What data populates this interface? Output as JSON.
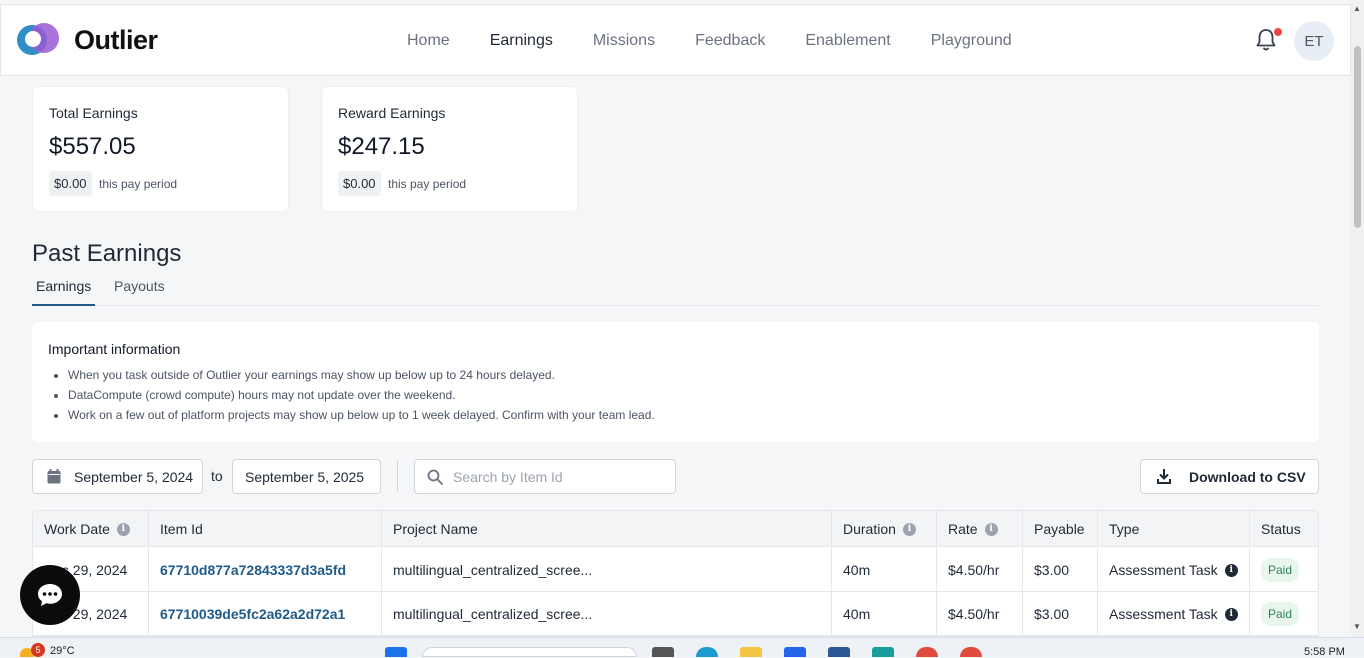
{
  "app": {
    "name": "Outlier",
    "nav": [
      "Home",
      "Earnings",
      "Missions",
      "Feedback",
      "Enablement",
      "Playground"
    ],
    "active_nav": "Earnings",
    "avatar_initials": "ET"
  },
  "cards": [
    {
      "title": "Total Earnings",
      "amount": "$557.05",
      "period_amount": "$0.00",
      "period_label": "this pay period"
    },
    {
      "title": "Reward Earnings",
      "amount": "$247.15",
      "period_amount": "$0.00",
      "period_label": "this pay period"
    }
  ],
  "past_earnings": {
    "title": "Past Earnings",
    "tabs": [
      "Earnings",
      "Payouts"
    ],
    "active_tab": "Earnings"
  },
  "info": {
    "title": "Important information",
    "items": [
      "When you task outside of Outlier your earnings may show up below up to 24 hours delayed.",
      "DataCompute (crowd compute) hours may not update over the weekend.",
      "Work on a few out of platform projects may show up below up to 1 week delayed. Confirm with your team lead."
    ]
  },
  "filters": {
    "start_date": "September 5, 2024",
    "to_label": "to",
    "end_date": "September 5, 2025",
    "search_placeholder": "Search by Item Id",
    "download_label": "Download to CSV"
  },
  "table": {
    "columns": [
      "Work Date",
      "Item Id",
      "Project Name",
      "Duration",
      "Rate",
      "Payable",
      "Type",
      "Status"
    ],
    "rows": [
      {
        "work_date": "Dec 29, 2024",
        "item_id": "67710d877a72843337d3a5fd",
        "project": "multilingual_centralized_scree...",
        "duration": "40m",
        "rate": "$4.50/hr",
        "payable": "$3.00",
        "type": "Assessment Task",
        "status": "Paid"
      },
      {
        "work_date": "Dec 29, 2024",
        "item_id": "67710039de5fc2a62a2d72a1",
        "project": "multilingual_centralized_scree...",
        "duration": "40m",
        "rate": "$4.50/hr",
        "payable": "$3.00",
        "type": "Assessment Task",
        "status": "Paid"
      }
    ]
  },
  "taskbar": {
    "weather_badge": "5",
    "temperature": "29°C",
    "time": "5:58 PM"
  },
  "colors": {
    "accent": "#1e5a8a",
    "paid_bg": "#e8f6ec",
    "paid_text": "#2f855a",
    "notification_dot": "#ef4444"
  }
}
